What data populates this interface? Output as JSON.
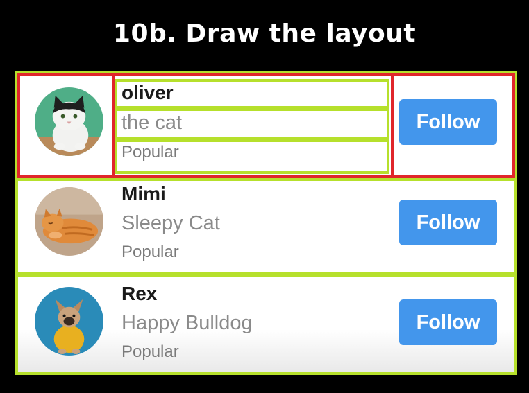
{
  "title": "10b. Draw the layout",
  "users": [
    {
      "name": "oliver",
      "subtitle": "the cat",
      "tag": "Popular",
      "button": "Follow",
      "avatar": "cat-avatar-icon"
    },
    {
      "name": "Mimi",
      "subtitle": "Sleepy Cat",
      "tag": "Popular",
      "button": "Follow",
      "avatar": "sleeping-cat-avatar-icon"
    },
    {
      "name": "Rex",
      "subtitle": "Happy Bulldog",
      "tag": "Popular",
      "button": "Follow",
      "avatar": "bulldog-avatar-icon"
    }
  ],
  "colors": {
    "background": "#000000",
    "highlight_green": "#b6e02c",
    "highlight_red": "#e0262b",
    "button_blue": "#4396ec"
  }
}
